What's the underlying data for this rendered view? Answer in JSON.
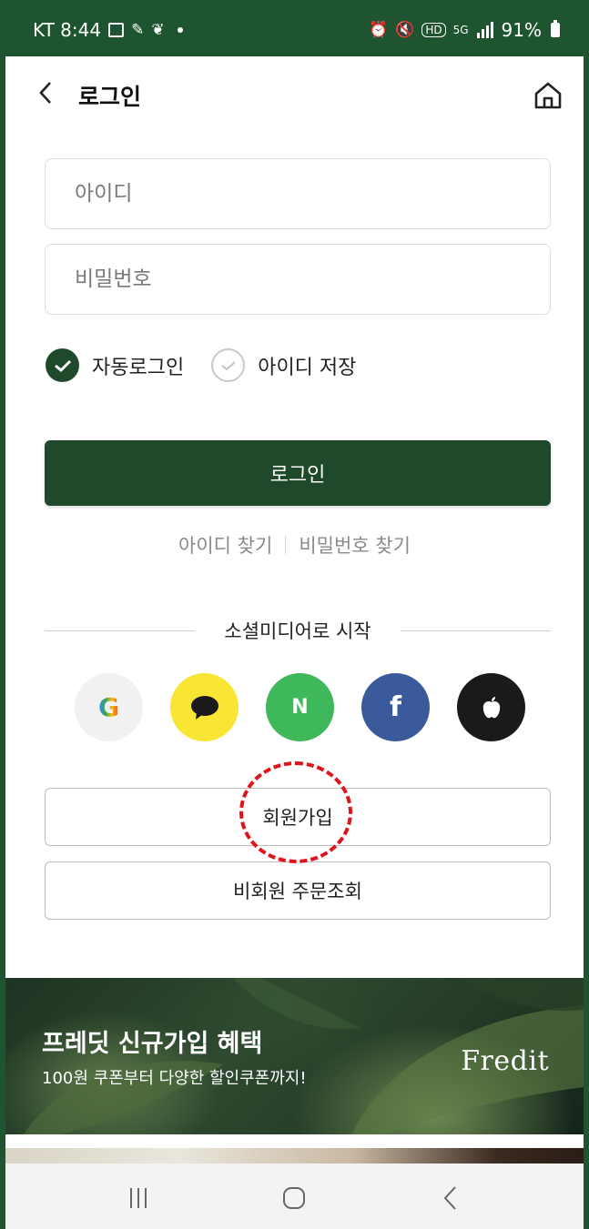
{
  "status_bar": {
    "carrier_time": "KT 8:44",
    "network": "5G",
    "battery": "91%"
  },
  "header": {
    "title": "로그인"
  },
  "form": {
    "id_placeholder": "아이디",
    "password_placeholder": "비밀번호",
    "auto_login_label": "자동로그인",
    "auto_login_checked": true,
    "save_id_label": "아이디 저장",
    "save_id_checked": false,
    "login_button": "로그인"
  },
  "find_links": {
    "find_id": "아이디 찾기",
    "find_password": "비밀번호 찾기"
  },
  "social": {
    "heading": "소셜미디어로 시작",
    "providers": [
      "google",
      "kakao",
      "naver",
      "facebook",
      "apple"
    ],
    "google_letter": "G",
    "naver_letter": "N",
    "facebook_letter": "f"
  },
  "buttons": {
    "signup": "회원가입",
    "guest_order": "비회원 주문조회"
  },
  "banner": {
    "title": "프레딧 신규가입 혜택",
    "subtitle": "100원 쿠폰부터 다양한 할인쿠폰까지!",
    "brand": "Fredit"
  },
  "colors": {
    "brand_green": "#1e4a2b",
    "status_green": "#1e5530",
    "annotation_red": "#e0141c"
  }
}
